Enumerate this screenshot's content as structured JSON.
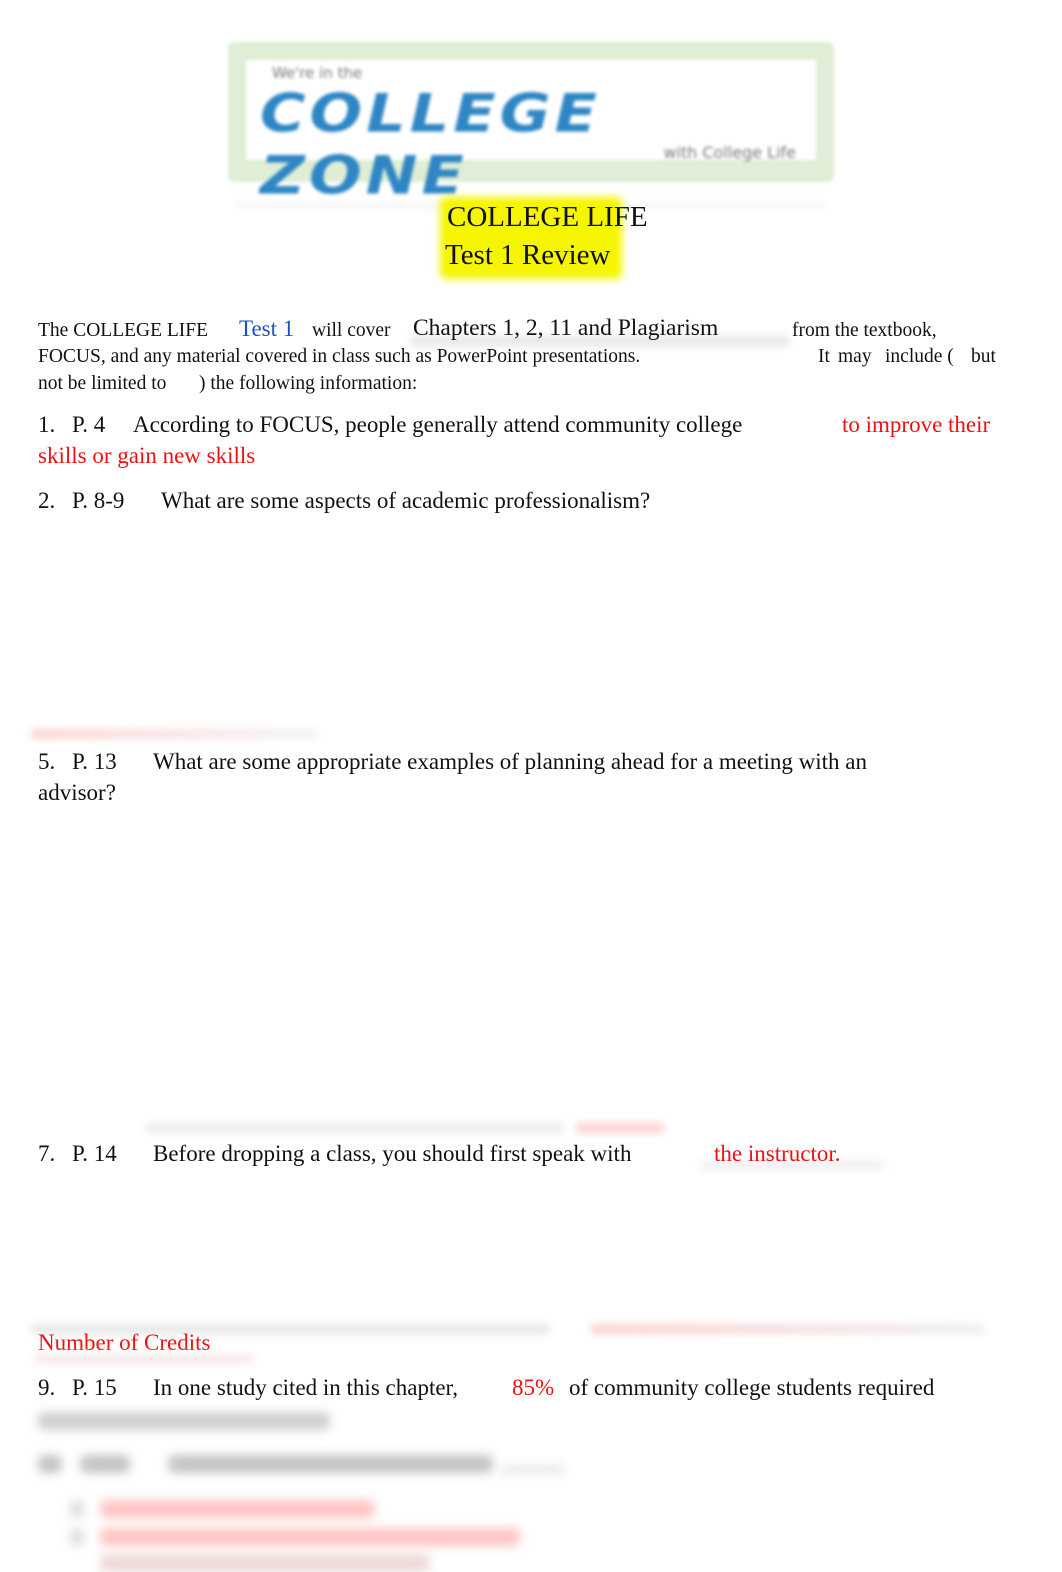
{
  "logo": {
    "small_text": "We're in the",
    "main_text": "COLLEGE ZONE",
    "sub_text": "with College Life"
  },
  "title": {
    "line1": "COLLEGE LIFE",
    "line2": "Test 1 Review",
    "highlight_color": "#f5f500"
  },
  "intro": {
    "part1": "The COLLEGE LIFE",
    "test_name": "Test 1",
    "part2": "will cover",
    "chapters": "Chapters 1, 2, 11 and Plagiarism",
    "part3": "from the textbook,",
    "line2a": "FOCUS, and any material covered in class such as PowerPoint presentations.",
    "line2b_1": "It",
    "line2b_2": "may",
    "line2b_3": "include (",
    "line2b_4": "but",
    "line3a": "not be limited to",
    "line3b": ") the following information:"
  },
  "questions": [
    {
      "number": "1.",
      "page": "P. 4",
      "text": "According to FOCUS, people generally attend community college",
      "answer_line1": "to improve their",
      "answer_line2": "skills or gain new skills"
    },
    {
      "number": "2.",
      "page": "P. 8-9",
      "text": "What are some aspects of academic professionalism?"
    },
    {
      "number": "5.",
      "page": "P. 13",
      "text": "What are some appropriate examples of planning ahead for a meeting with an",
      "text_line2": "advisor?"
    },
    {
      "number": "7.",
      "page": "P. 14",
      "text": "Before dropping a class, you should first speak with",
      "answer": "the instructor."
    },
    {
      "answer_only": "Number of Credits"
    },
    {
      "number": "9.",
      "page": "P. 15",
      "text_before": "In one study cited in this chapter,",
      "answer": "85%",
      "text_after": "of community college students required"
    }
  ],
  "colors": {
    "answer_red": "#ee1111",
    "test_blue": "#1f4fc8",
    "logo_blue": "#2e86c4",
    "logo_border_green": "#dfeed5"
  }
}
